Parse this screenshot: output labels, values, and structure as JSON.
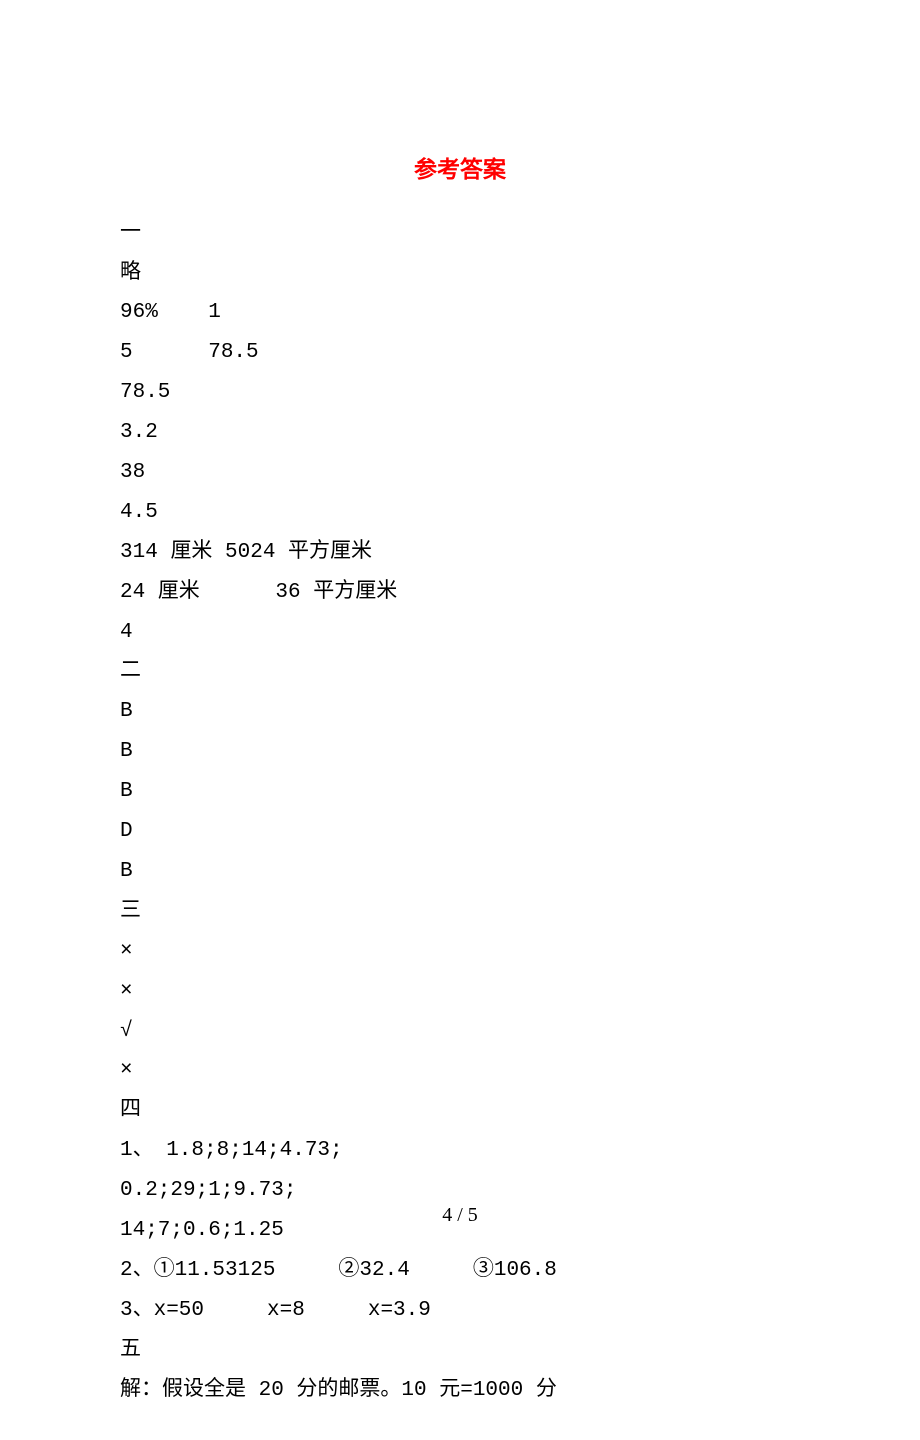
{
  "title": "参考答案",
  "lines": [
    "一",
    "略",
    "96%    1",
    "5      78.5",
    "78.5",
    "3.2",
    "38",
    "4.5",
    "314 厘米 5024 平方厘米",
    "24 厘米      36 平方厘米",
    "4",
    "二",
    "B",
    "B",
    "B",
    "D",
    "B",
    "三",
    "×",
    "×",
    "√",
    "×",
    "四",
    "1、 1.8;8;14;4.73;",
    "0.2;29;1;9.73;",
    "14;7;0.6;1.25",
    "2、①11.53125     ②32.4     ③106.8",
    "3、x=50     x=8     x=3.9",
    "五",
    "解：假设全是 20 分的邮票。10 元=1000 分"
  ],
  "page_number": "4 / 5"
}
